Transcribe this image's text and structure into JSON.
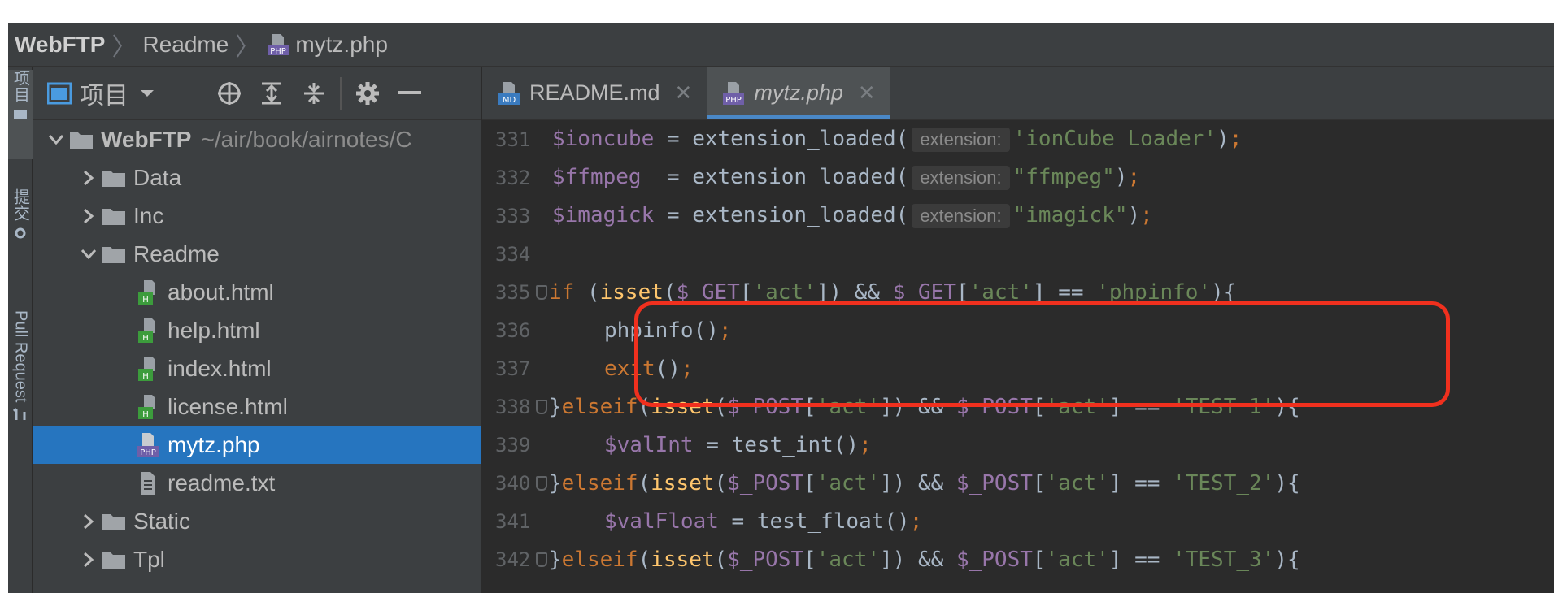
{
  "breadcrumb": {
    "items": [
      "WebFTP",
      "Readme",
      "mytz.php"
    ]
  },
  "left_strip": {
    "tabs": [
      {
        "label": "项目",
        "icon": "folder-icon"
      },
      {
        "label": "提交",
        "icon": "commit-icon"
      },
      {
        "label": "Pull Request",
        "icon": "pull-request-icon"
      }
    ]
  },
  "project_panel": {
    "title": "项目",
    "toolbar_icons": [
      "locate-icon",
      "expand-all-icon",
      "collapse-all-icon",
      "settings-icon",
      "hide-icon"
    ],
    "tree": [
      {
        "label": "WebFTP",
        "path": "~/air/book/airnotes/C",
        "type": "folder",
        "expanded": true,
        "depth": 0
      },
      {
        "label": "Data",
        "type": "folder",
        "expanded": false,
        "depth": 1
      },
      {
        "label": "Inc",
        "type": "folder",
        "expanded": false,
        "depth": 1
      },
      {
        "label": "Readme",
        "type": "folder",
        "expanded": true,
        "depth": 1
      },
      {
        "label": "about.html",
        "type": "html",
        "depth": 2
      },
      {
        "label": "help.html",
        "type": "html",
        "depth": 2
      },
      {
        "label": "index.html",
        "type": "html",
        "depth": 2
      },
      {
        "label": "license.html",
        "type": "html",
        "depth": 2
      },
      {
        "label": "mytz.php",
        "type": "php",
        "depth": 2,
        "selected": true
      },
      {
        "label": "readme.txt",
        "type": "txt",
        "depth": 2
      },
      {
        "label": "Static",
        "type": "folder",
        "expanded": false,
        "depth": 1
      },
      {
        "label": "Tpl",
        "type": "folder",
        "expanded": false,
        "depth": 1
      }
    ]
  },
  "editor": {
    "tabs": [
      {
        "label": "README.md",
        "icon": "markdown-file-icon",
        "active": false
      },
      {
        "label": "mytz.php",
        "icon": "php-file-icon",
        "active": true
      }
    ],
    "line_numbers": [
      "331",
      "332",
      "333",
      "334",
      "335",
      "336",
      "337",
      "338",
      "339",
      "340",
      "341",
      "342"
    ],
    "hint_label": "extension:",
    "strings": {
      "ioncube": "'ionCube Loader'",
      "ffmpeg": "\"ffmpeg\"",
      "imagick": "\"imagick\"",
      "act": "'act'",
      "phpinfo": "'phpinfo'",
      "test1": "'TEST_1'",
      "test2": "'TEST_2'",
      "test3": "'TEST_3'"
    }
  },
  "colors": {
    "highlight_box": "#f0301e",
    "selection": "#2675bf",
    "variable": "#9876aa",
    "keyword": "#cc7832",
    "string": "#6a8759",
    "function": "#ffc66d"
  }
}
